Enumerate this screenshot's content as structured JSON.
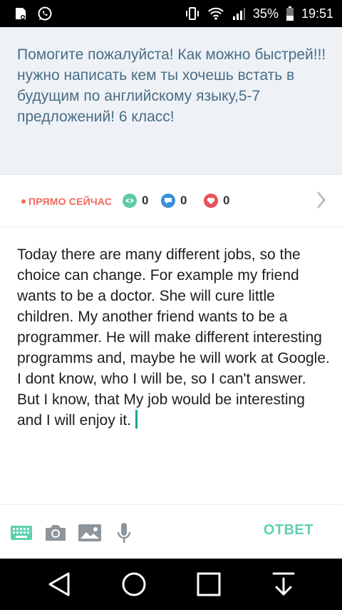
{
  "status_bar": {
    "battery_percent": "35%",
    "time": "19:51",
    "icons": [
      "notification-icon",
      "whatsapp-icon",
      "vibrate-icon",
      "wifi-icon",
      "signal-icon",
      "battery-icon"
    ]
  },
  "question": {
    "text": "Помогите пожалуйста! Как можно быстрей!!!нужно написать кем ты хочешь встать в будущим по английскому языку,5-7 предложений! 6 класс!"
  },
  "meta": {
    "live_label": "ПРЯМО СЕЙЧАС",
    "views": "0",
    "comments": "0",
    "likes": "0",
    "colors": {
      "live": "#f06a5b",
      "views": "#5dc9a8",
      "comments": "#3a8fd9",
      "likes": "#e8505b"
    }
  },
  "answer": {
    "text": "Today there are many different jobs, so the choice can change. For example my friend wants to be a doctor. She will cure little children. My another friend wants to be a programmer. He will make different interesting programms and, maybe he will work at Google. I dont know, who I will be, so I can't answer. But I know, that My job would be interesting and I will enjoy it."
  },
  "toolbar": {
    "icons": [
      "keyboard-icon",
      "camera-icon",
      "image-icon",
      "microphone-icon"
    ],
    "submit_label": "ОТВЕТ",
    "accent": "#5dd1b0"
  },
  "nav_bar": {
    "icons": [
      "back-icon",
      "home-icon",
      "recents-icon",
      "download-icon"
    ]
  }
}
